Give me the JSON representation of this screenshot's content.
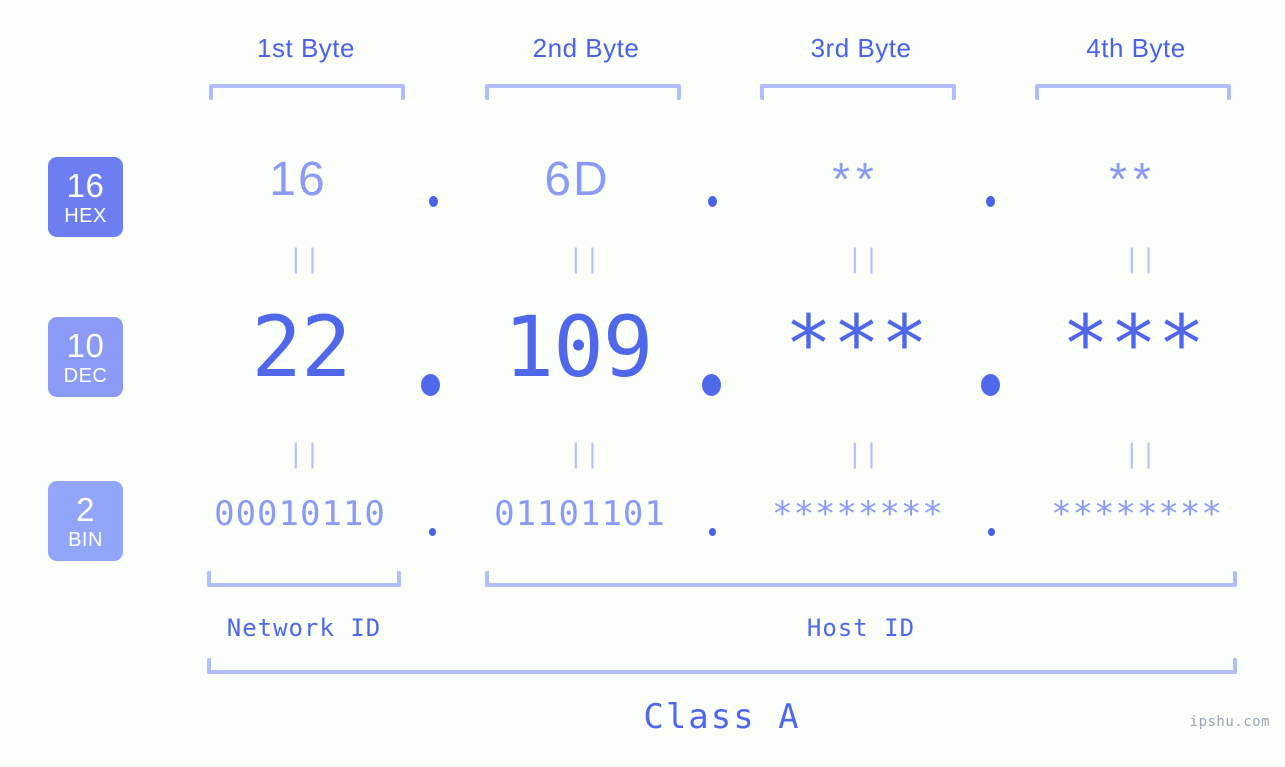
{
  "background_color": "#fbfdf9",
  "accent_color": "#4f68ea",
  "light_accent_color": "#8b9bf5",
  "bracket_color": "#b2bdfb",
  "headers": {
    "byte1": "1st Byte",
    "byte2": "2nd Byte",
    "byte3": "3rd Byte",
    "byte4": "4th Byte"
  },
  "bases": [
    {
      "number": "16",
      "name": "HEX",
      "color": "#6d7ef0"
    },
    {
      "number": "10",
      "name": "DEC",
      "color": "#8b9bf5"
    },
    {
      "number": "2",
      "name": "BIN",
      "color": "#92a6f9"
    }
  ],
  "rows": {
    "hex": {
      "octet1": "16",
      "octet2": "6D",
      "octet3": "**",
      "octet4": "**"
    },
    "dec": {
      "octet1": "22",
      "octet2": "109",
      "octet3": "***",
      "octet4": "***"
    },
    "bin": {
      "octet1": "00010110",
      "octet2": "01101101",
      "octet3": "********",
      "octet4": "********"
    }
  },
  "separators": {
    "dot": ".",
    "equals_mark": "||"
  },
  "footer": {
    "network_id": "Network ID",
    "host_id": "Host ID",
    "class_label": "Class A",
    "watermark": "ipshu.com"
  }
}
